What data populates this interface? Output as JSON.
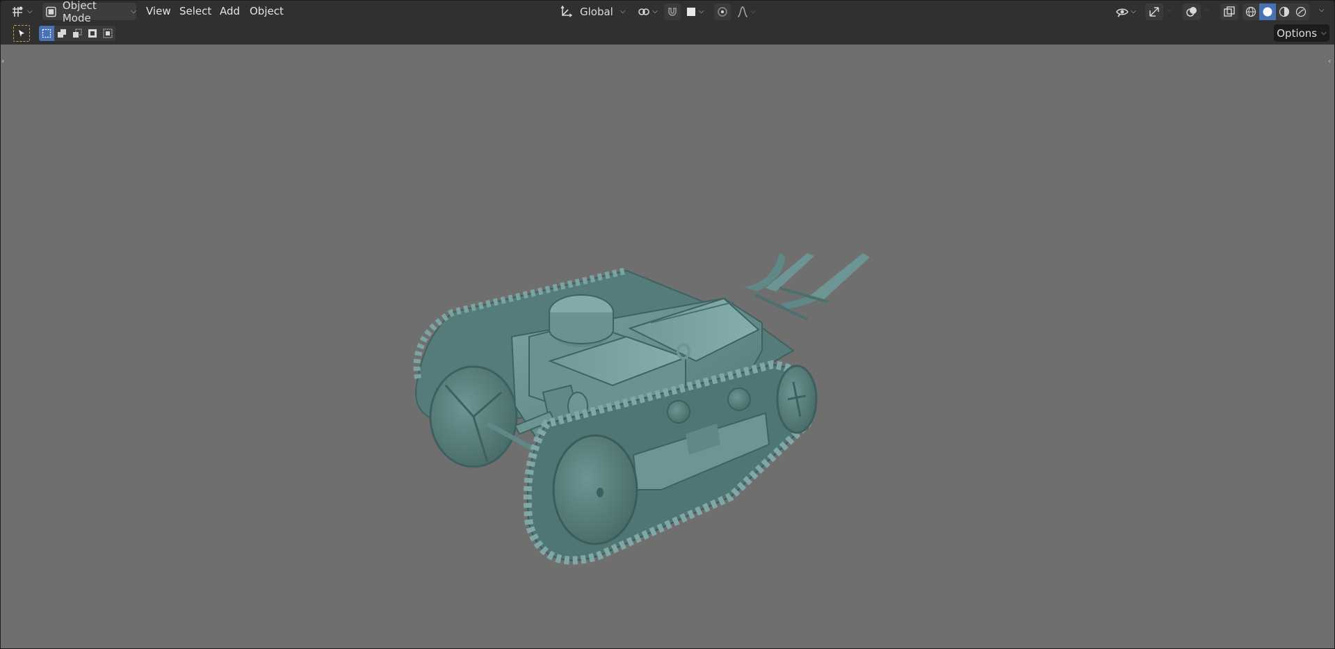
{
  "header": {
    "editor_type_icon": "move-tool-icon",
    "mode": {
      "icon": "object-mode-icon",
      "label": "Object Mode"
    },
    "menus": [
      "View",
      "Select",
      "Add",
      "Object"
    ],
    "transform_orientation": {
      "icon": "orientation-icon",
      "label": "Global"
    },
    "pivot_icon": "pivot-point-icon",
    "snap_icon": "magnet-icon",
    "snap_target_icon": "snap-square-icon",
    "proportional_icon": "proportional-editing-icon",
    "falloff_icon": "falloff-curve-icon",
    "visibility_icon": "eye-icon",
    "gizmo_icon": "gizmo-icon",
    "overlay_icon": "overlay-icon",
    "xray_icon": "xray-icon",
    "shading_modes": [
      "wireframe-icon",
      "solid-icon",
      "material-preview-icon",
      "rendered-icon"
    ],
    "active_shading": "solid-icon"
  },
  "tool_settings": {
    "active_tool_icon": "select-box-cursor-icon",
    "select_modes": [
      "set-new-selection-icon",
      "extend-selection-icon",
      "subtract-selection-icon",
      "invert-selection-icon",
      "intersect-selection-icon"
    ],
    "options_label": "Options"
  },
  "colors": {
    "viewport_bg": "#6f6f6f",
    "header_bg": "#303030",
    "accent": "#4772b3",
    "model": "#5d8482"
  }
}
